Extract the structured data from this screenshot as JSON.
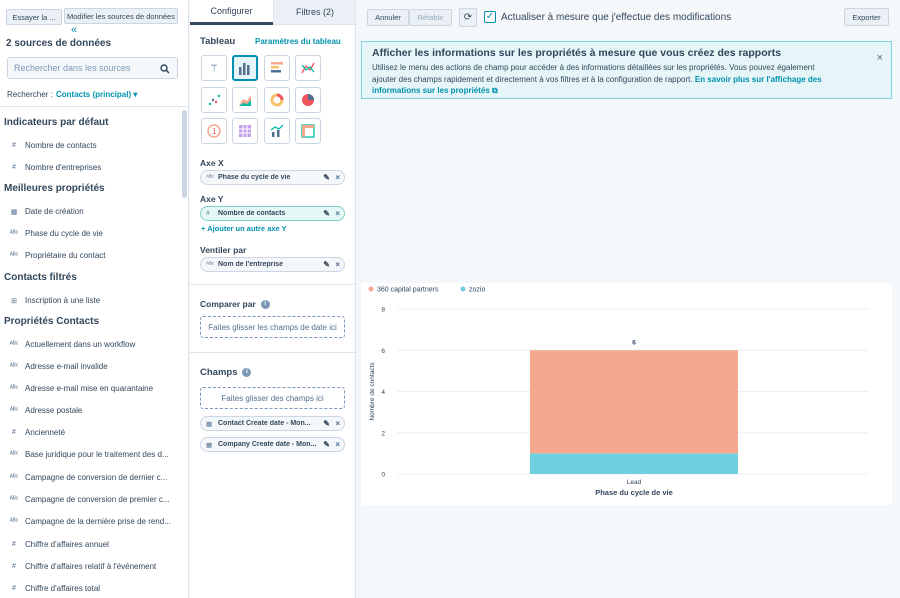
{
  "left": {
    "try_btn": "Essayer la ...",
    "modify_btn": "Modifier les sources de données",
    "title": "2 sources de données",
    "search_placeholder": "Rechercher dans les sources",
    "search_in_label": "Rechercher :",
    "search_in_value": "Contacts (principal)",
    "sections": [
      {
        "title": "Indicateurs par défaut",
        "items": [
          {
            "icon": "#",
            "label": "Nombre de contacts"
          },
          {
            "icon": "#",
            "label": "Nombre d'entreprises"
          }
        ]
      },
      {
        "title": "Meilleures propriétés",
        "items": [
          {
            "icon": "▦",
            "label": "Date de création"
          },
          {
            "icon": "ᴬᴮᶜ",
            "label": "Phase du cycle de vie"
          },
          {
            "icon": "ᴬᴮᶜ",
            "label": "Propriétaire du contact"
          }
        ]
      },
      {
        "title": "Contacts filtrés",
        "items": [
          {
            "icon": "⊞",
            "label": "Inscription à une liste"
          }
        ]
      },
      {
        "title": "Propriétés Contacts",
        "items": [
          {
            "icon": "ᴬᴮᶜ",
            "label": "Actuellement dans un workflow"
          },
          {
            "icon": "ᴬᴮᶜ",
            "label": "Adresse e-mail invalide"
          },
          {
            "icon": "ᴬᴮᶜ",
            "label": "Adresse e-mail mise en quarantaine"
          },
          {
            "icon": "ᴬᴮᶜ",
            "label": "Adresse postale"
          },
          {
            "icon": "#",
            "label": "Ancienneté"
          },
          {
            "icon": "ᴬᴮᶜ",
            "label": "Base juridique pour le traitement des d..."
          },
          {
            "icon": "ᴬᴮᶜ",
            "label": "Campagne de conversion de dernier c..."
          },
          {
            "icon": "ᴬᴮᶜ",
            "label": "Campagne de conversion de premier c..."
          },
          {
            "icon": "ᴬᴮᶜ",
            "label": "Campagne de la dernière prise de rend..."
          },
          {
            "icon": "#",
            "label": "Chiffre d'affaires annuel"
          },
          {
            "icon": "#",
            "label": "Chiffre d'affaires relatif à l'événement"
          },
          {
            "icon": "#",
            "label": "Chiffre d'affaires total"
          }
        ]
      }
    ]
  },
  "mid": {
    "tab_config": "Configurer",
    "tab_filters": "Filtres (2)",
    "table_title": "Tableau",
    "table_params": "Paramètres du tableau",
    "axis_x_label": "Axe X",
    "axis_x_value": "Phase du cycle de vie",
    "axis_y_label": "Axe Y",
    "axis_y_value": "Nombre de contacts",
    "add_axis": "Ajouter un autre axe Y",
    "split_label": "Ventiler par",
    "split_value": "Nom de l'entreprise",
    "compare_label": "Comparer par",
    "compare_drop": "Faites glisser les champs de date ici",
    "fields_label": "Champs",
    "fields_drop": "Faites glisser des champs ici",
    "field1": "Contact Create date - Mon...",
    "field2": "Company Create date - Mon..."
  },
  "toolbar": {
    "undo": "Annuler",
    "redo": "Rétablir",
    "auto_update": "Actualiser à mesure que j'effectue des modifications",
    "export": "Exporter"
  },
  "banner": {
    "title": "Afficher les informations sur les propriétés à mesure que vous créez des rapports",
    "body": "Utilisez le menu des actions de champ pour accéder à des informations détaillées sur les propriétés. Vous pouvez également ajouter des champs rapidement et directement à vos filtres et à la configuration de rapport.",
    "link": "En savoir plus sur l'affichage des informations sur les propriétés"
  },
  "chart_data": {
    "type": "bar",
    "stacked": true,
    "categories": [
      "Lead"
    ],
    "series": [
      {
        "name": "360 capital partners",
        "values": [
          5
        ],
        "color": "#f5a88e"
      },
      {
        "name": "zozio",
        "values": [
          1
        ],
        "color": "#6fd1e0"
      }
    ],
    "total_labels": [
      "6"
    ],
    "xlabel": "Phase du cycle de vie",
    "ylabel": "Nombre de contacts",
    "ylim": [
      0,
      8
    ],
    "yticks": [
      0,
      2,
      4,
      6,
      8
    ],
    "legend": "top-left",
    "grid": true
  }
}
